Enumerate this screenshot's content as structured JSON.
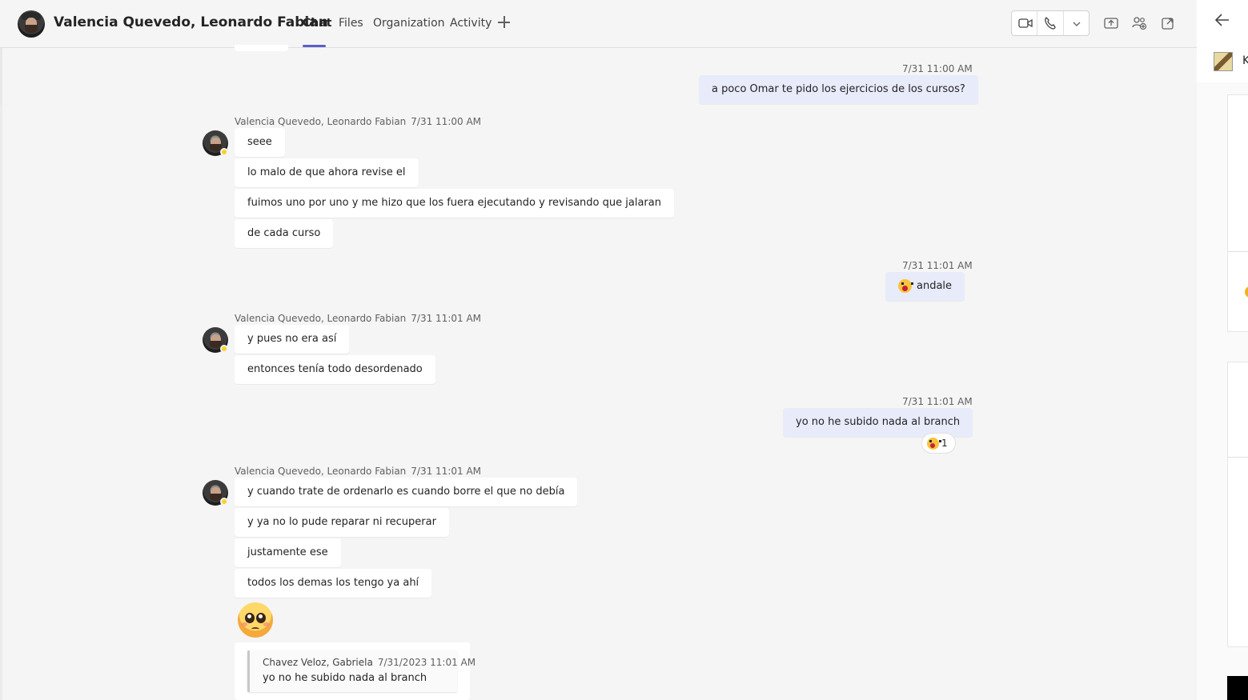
{
  "header": {
    "title": "Valencia Quevedo, Leonardo Fabian",
    "tabs": [
      {
        "label": "Chat",
        "active": true
      },
      {
        "label": "Files",
        "active": false
      },
      {
        "label": "Organization",
        "active": false
      },
      {
        "label": "Activity",
        "active": false
      }
    ],
    "icons": [
      "video-call-icon",
      "audio-call-icon",
      "chevron-down-icon",
      "share-screen-icon",
      "add-people-icon",
      "pop-out-icon"
    ],
    "accent_color": "#5b5fc7"
  },
  "right_panel": {
    "back_icon": "arrow-left-icon",
    "truncated_label": "K"
  },
  "messages": {
    "m1": {
      "time": "7/31 11:00 AM",
      "text": "a poco Omar te pido los ejercicios de los cursos?"
    },
    "g1": {
      "sender": "Valencia Quevedo, Leonardo Fabian",
      "time": "7/31 11:00 AM",
      "lines": [
        "seee",
        "lo malo de que ahora revise el",
        "fuimos uno por uno y me hizo que los fuera ejecutando y revisando que jalaran",
        "de cada curso"
      ]
    },
    "m2": {
      "time": "7/31 11:01 AM",
      "text": "andale",
      "emoji": "astonished-face"
    },
    "g2": {
      "sender": "Valencia Quevedo, Leonardo Fabian",
      "time": "7/31 11:01 AM",
      "lines": [
        "y pues no era así",
        "entonces tenía todo desordenado"
      ]
    },
    "m3": {
      "time": "7/31 11:01 AM",
      "text": "yo no he subido nada al branch",
      "reaction_count": "1",
      "reaction_emoji": "astonished-face"
    },
    "g3": {
      "sender": "Valencia Quevedo, Leonardo Fabian",
      "time": "7/31 11:01 AM",
      "lines": [
        "y cuando trate de ordenarlo es cuando borre el que no debía",
        "y ya no lo pude reparar ni recuperar",
        "justamente ese",
        "todos los demas los tengo ya ahí"
      ],
      "big_emoji": "pleading-face",
      "quote": {
        "author": "Chavez Veloz, Gabriela",
        "time": "7/31/2023 11:01 AM",
        "text": "yo no he subido nada al branch"
      }
    }
  },
  "colors": {
    "my_bubble": "#e8ebfa",
    "presence_away": "#f8d22a"
  }
}
